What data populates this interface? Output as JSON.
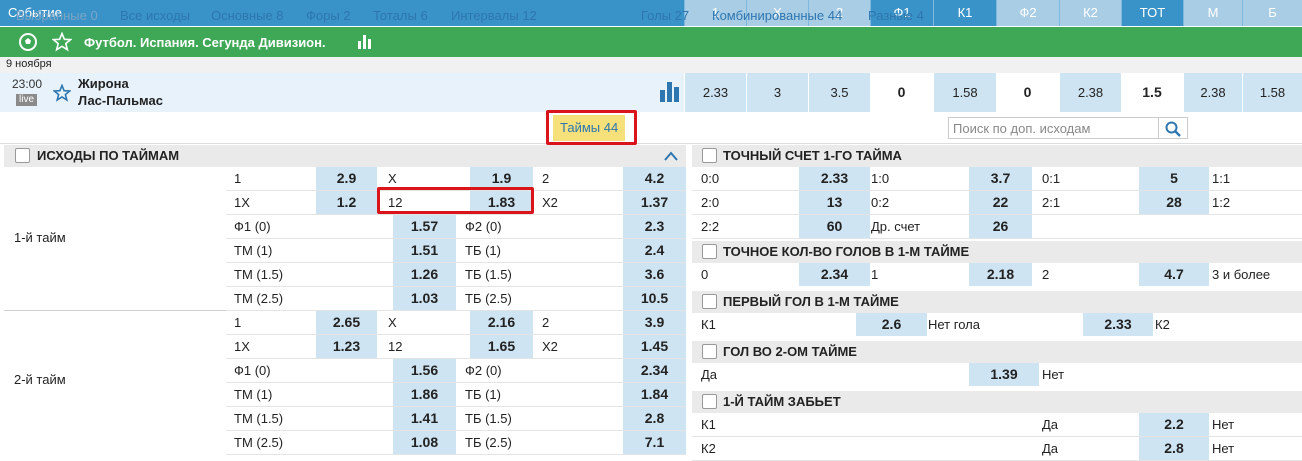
{
  "header": {
    "event_label": "Событие",
    "cols": [
      "1",
      "X",
      "2",
      "Ф1",
      "К1",
      "Ф2",
      "К2",
      "ТОТ",
      "М",
      "Б"
    ]
  },
  "league": {
    "name": "Футбол. Испания. Сегунда Дивизион."
  },
  "date": "9 ноября",
  "match": {
    "time": "23:00",
    "live": "live",
    "team1": "Жирона",
    "team2": "Лас-Пальмас",
    "odds": [
      "2.33",
      "3",
      "3.5",
      "0",
      "1.58",
      "0",
      "2.38",
      "1.5",
      "2.38",
      "1.58"
    ]
  },
  "tabs": [
    "Выбранные 0",
    "Все исходы",
    "Основные 8",
    "Форы 2",
    "Тоталы 6",
    "Интервалы 12",
    "Таймы 44",
    "Голы 27",
    "Комбинированные 44",
    "Разные 4"
  ],
  "search": {
    "placeholder": "Поиск по доп. исходам"
  },
  "left": {
    "title": "ИСХОДЫ ПО ТАЙМАМ",
    "h1": {
      "label": "1-й тайм",
      "rows": [
        [
          "1",
          "2.9",
          "X",
          "1.9",
          "2",
          "4.2"
        ],
        [
          "1X",
          "1.2",
          "12",
          "1.83",
          "X2",
          "1.37"
        ],
        [
          "Ф1 (0)",
          "1.57",
          "Ф2 (0)",
          "2.3"
        ],
        [
          "ТМ (1)",
          "1.51",
          "ТБ (1)",
          "2.4"
        ],
        [
          "ТМ (1.5)",
          "1.26",
          "ТБ (1.5)",
          "3.6"
        ],
        [
          "ТМ (2.5)",
          "1.03",
          "ТБ (2.5)",
          "10.5"
        ]
      ]
    },
    "h2": {
      "label": "2-й тайм",
      "rows": [
        [
          "1",
          "2.65",
          "X",
          "2.16",
          "2",
          "3.9"
        ],
        [
          "1X",
          "1.23",
          "12",
          "1.65",
          "X2",
          "1.45"
        ],
        [
          "Ф1 (0)",
          "1.56",
          "Ф2 (0)",
          "2.34"
        ],
        [
          "ТМ (1)",
          "1.86",
          "ТБ (1)",
          "1.84"
        ],
        [
          "ТМ (1.5)",
          "1.41",
          "ТБ (1.5)",
          "2.8"
        ],
        [
          "ТМ (2.5)",
          "1.08",
          "ТБ (2.5)",
          "7.1"
        ]
      ]
    }
  },
  "right": {
    "exact": {
      "title": "ТОЧНЫЙ СЧЕТ 1-ГО ТАЙМА",
      "rows": [
        [
          "0:0",
          "2.33",
          "1:0",
          "3.7",
          "0:1",
          "5",
          "1:1"
        ],
        [
          "2:0",
          "13",
          "0:2",
          "22",
          "2:1",
          "28",
          "1:2"
        ],
        [
          "2:2",
          "60",
          "Др. счет",
          "26"
        ]
      ]
    },
    "goals": {
      "title": "ТОЧНОЕ КОЛ-ВО ГОЛОВ В 1-М ТАЙМЕ",
      "row": [
        "0",
        "2.34",
        "1",
        "2.18",
        "2",
        "4.7",
        "3 и более"
      ]
    },
    "first": {
      "title": "ПЕРВЫЙ ГОЛ В 1-М ТАЙМЕ",
      "row": [
        "К1",
        "2.6",
        "Нет гола",
        "2.33",
        "К2"
      ]
    },
    "second": {
      "title": "ГОЛ ВО 2-ОМ ТАЙМЕ",
      "row": [
        "Да",
        "1.39",
        "Нет"
      ]
    },
    "scores": {
      "title": "1-Й ТАЙМ ЗАБЬЕТ",
      "rows": [
        [
          "К1",
          "Да",
          "2.2",
          "Нет"
        ],
        [
          "К2",
          "Да",
          "2.8",
          "Нет"
        ]
      ]
    }
  }
}
